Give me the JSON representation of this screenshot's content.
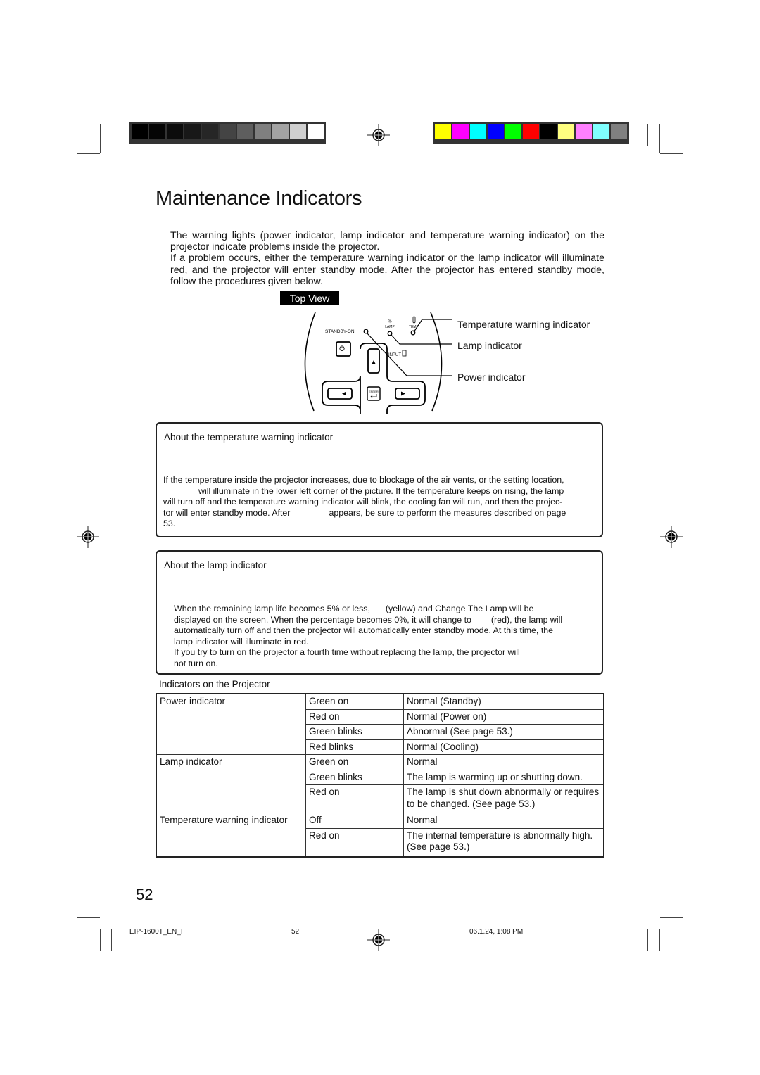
{
  "print_marks": {
    "grayscale_swatches": [
      "#000000",
      "#050505",
      "#0c0c0c",
      "#181818",
      "#262626",
      "#444444",
      "#5e5e5e",
      "#7f7f7f",
      "#a3a3a3",
      "#cfcfcf",
      "#ffffff"
    ],
    "color_swatches": [
      "#ffff00",
      "#ff00ff",
      "#00ffff",
      "#0000ff",
      "#00ff00",
      "#ff0000",
      "#000000",
      "#ffff80",
      "#ff80ff",
      "#80ffff",
      "#808080"
    ]
  },
  "page": {
    "title": "Maintenance Indicators",
    "intro": [
      "The warning lights (power indicator, lamp indicator and temperature warning indicator) on the projector indicate problems inside the projector.",
      "If a problem occurs, either the temperature warning indicator or the lamp indicator will illuminate red, and the projector will enter standby mode. After the projector has entered standby mode, follow the procedures given below."
    ],
    "top_view_label": "Top View"
  },
  "diagram": {
    "labels": {
      "standby_on": "STANDBY-ON",
      "lamp": "LAMP",
      "temp": "TEMP",
      "input": "INPUT",
      "enter": "ENTER"
    },
    "callouts": {
      "temperature": "Temperature warning indicator",
      "lamp": "Lamp indicator",
      "power": "Power indicator"
    }
  },
  "temp_box": {
    "title": "About the temperature warning indicator",
    "line1": "If the temperature inside the projector increases, due to blockage of the air vents, or the setting location,",
    "line2": "will illuminate in the lower left corner of the picture. If the temperature keeps on rising, the lamp",
    "line3": "will turn off and the temperature warning indicator will blink, the cooling fan will run, and then the projec-",
    "line4a": "tor will enter standby mode. After",
    "line4b": "appears, be sure to perform the measures described on page",
    "line5": "53."
  },
  "lamp_box": {
    "title": "About the lamp indicator",
    "line1a": "When the remaining lamp life becomes 5% or less,",
    "line1b": "(yellow) and  Change The Lamp  will be",
    "line2a": "displayed on the screen. When the percentage becomes 0%, it will change to",
    "line2b": "(red), the lamp will",
    "line3": "automatically turn off and then the projector will automatically enter standby mode. At this time, the",
    "line4": "lamp indicator will illuminate in red.",
    "line5": "If you try to turn on the projector a fourth time without replacing the lamp, the projector will",
    "line6": "not turn on."
  },
  "table": {
    "caption": "Indicators on the Projector",
    "groups": [
      {
        "name": "Power indicator",
        "rows": [
          {
            "state": "Green on",
            "meaning": "Normal (Standby)"
          },
          {
            "state": "Red on",
            "meaning": "Normal (Power on)"
          },
          {
            "state": "Green blinks",
            "meaning": "Abnormal (See page  53.)"
          },
          {
            "state": "Red blinks",
            "meaning": "Normal (Cooling)"
          }
        ]
      },
      {
        "name": "Lamp indicator",
        "rows": [
          {
            "state": "Green on",
            "meaning": "Normal"
          },
          {
            "state": "Green blinks",
            "meaning": "The lamp is warming up or shutting down."
          },
          {
            "state": "Red on",
            "meaning": "The lamp is shut down abnormally or requires to be changed. (See page  53.)"
          }
        ]
      },
      {
        "name": "Temperature warning indicator",
        "rows": [
          {
            "state": "Off",
            "meaning": "Normal"
          },
          {
            "state": "Red on",
            "meaning": "The internal temperature is abnormally high. (See page  53.)"
          }
        ]
      }
    ]
  },
  "page_number": "52",
  "footer": {
    "file": "EIP-1600T_EN_I",
    "page": "52",
    "timestamp": "06.1.24, 1:08 PM"
  }
}
